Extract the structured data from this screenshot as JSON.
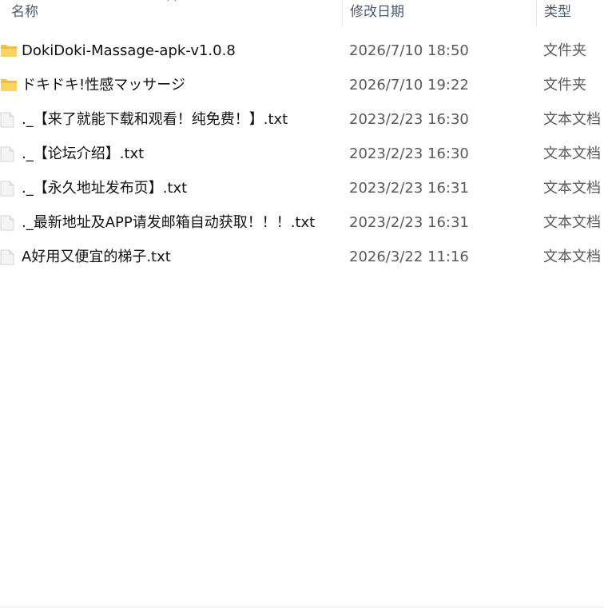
{
  "columns": {
    "name": "名称",
    "date": "修改日期",
    "type": "类型"
  },
  "colors": {
    "folder": "#f5c542",
    "folder_dark": "#e0a526",
    "file": "#e6e6e6",
    "header_text": "#4a5a6e"
  },
  "rows": [
    {
      "icon": "folder-icon",
      "name": "DokiDoki-Massage-apk-v1.0.8",
      "date": "2026/7/10 18:50",
      "type": "文件夹"
    },
    {
      "icon": "folder-icon",
      "name": "ドキドキ!性感マッサージ",
      "date": "2026/7/10 19:22",
      "type": "文件夹"
    },
    {
      "icon": "file-icon",
      "name": "._【来了就能下载和观看！纯免费！】.txt",
      "date": "2023/2/23 16:30",
      "type": "文本文档"
    },
    {
      "icon": "file-icon",
      "name": "._【论坛介绍】.txt",
      "date": "2023/2/23 16:30",
      "type": "文本文档"
    },
    {
      "icon": "file-icon",
      "name": "._【永久地址发布页】.txt",
      "date": "2023/2/23 16:31",
      "type": "文本文档"
    },
    {
      "icon": "file-icon",
      "name": "._最新地址及APP请发邮箱自动获取！！！.txt",
      "date": "2023/2/23 16:31",
      "type": "文本文档"
    },
    {
      "icon": "file-icon",
      "name": "A好用又便宜的梯子.txt",
      "date": "2026/3/22 11:16",
      "type": "文本文档"
    }
  ]
}
